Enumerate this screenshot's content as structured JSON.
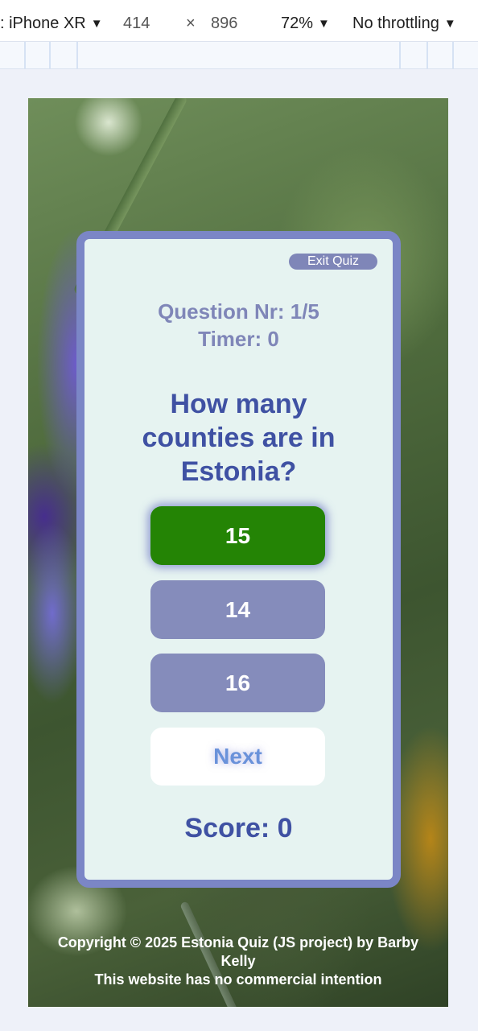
{
  "devtools": {
    "device_name": ": iPhone XR",
    "width": "414",
    "times": "×",
    "height": "896",
    "zoom": "72%",
    "throttling": "No throttling"
  },
  "quiz": {
    "exit_label": "Exit Quiz",
    "question_nr": "Question Nr: 1/5",
    "timer": "Timer: 0",
    "question": "How many counties are in Estonia?",
    "answers": [
      {
        "label": "15",
        "state": "correct"
      },
      {
        "label": "14",
        "state": "neutral"
      },
      {
        "label": "16",
        "state": "neutral"
      }
    ],
    "next_label": "Next",
    "score": "Score: 0"
  },
  "footer": {
    "copyright": "Copyright © 2025 Estonia Quiz (JS project) by Barby Kelly",
    "disclaimer": "This website has no commercial intention"
  },
  "colors": {
    "card_border": "#7b86c6",
    "card_bg": "#e6f3f1",
    "correct_answer": "#248405",
    "neutral_answer": "#858cbb",
    "heading_text": "#3f51a3",
    "info_text": "#7f86b8",
    "next_text": "#6a92da"
  }
}
